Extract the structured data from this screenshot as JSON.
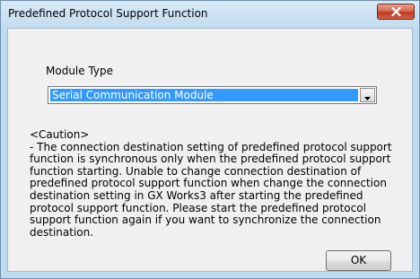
{
  "window": {
    "title": "Predefined Protocol Support Function",
    "close_icon": "close-x"
  },
  "module_type": {
    "label": "Module Type",
    "selected_value": "Serial Communication Module",
    "dropdown_icon": "chevron-down"
  },
  "caution": {
    "text": "<Caution>\n- The connection destination setting of predefined protocol support function is synchronous only when the predefined protocol support function starting. Unable to change connection destination of predefined protocol support function when change the connection destination setting in GX Works3 after starting the predefined protocol support function. Please start the predefined protocol support function again if you want to synchronize the connection destination."
  },
  "buttons": {
    "ok_label": "OK"
  },
  "colors": {
    "selection": "#3399ff",
    "close_button": "#c7432c",
    "frame": "#bfdbee"
  }
}
